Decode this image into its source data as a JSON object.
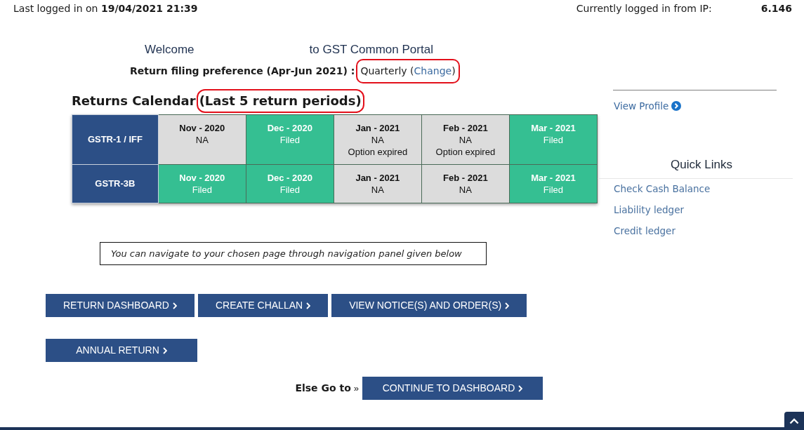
{
  "session": {
    "last_login_label": "Last logged in on",
    "last_login_time": "19/04/2021 21:39",
    "ip_label": "Currently logged in from IP:",
    "ip_value": "6.146"
  },
  "welcome": {
    "greeting": "Welcome",
    "portal": "to GST Common Portal"
  },
  "filing_preference": {
    "label": "Return filing preference (Apr-Jun 2021) :",
    "value": "Quarterly (",
    "link": "Change",
    "value_end": ")",
    "highlighted": true
  },
  "calendar": {
    "title": "Returns Calendar",
    "subtitle": "(Last 5 return periods)",
    "subtitle_highlighted": true,
    "rows": [
      {
        "return_type": "GSTR-1 / IFF",
        "periods": [
          {
            "period": "Nov - 2020",
            "status": "NA",
            "filed": false
          },
          {
            "period": "Dec - 2020",
            "status": "Filed",
            "filed": true
          },
          {
            "period": "Jan - 2021",
            "status": "NA",
            "note": "Option expired",
            "filed": false
          },
          {
            "period": "Feb - 2021",
            "status": "NA",
            "note": "Option expired",
            "filed": false
          },
          {
            "period": "Mar - 2021",
            "status": "Filed",
            "filed": true
          }
        ]
      },
      {
        "return_type": "GSTR-3B",
        "periods": [
          {
            "period": "Nov - 2020",
            "status": "Filed",
            "filed": true
          },
          {
            "period": "Dec - 2020",
            "status": "Filed",
            "filed": true
          },
          {
            "period": "Jan - 2021",
            "status": "NA",
            "filed": false
          },
          {
            "period": "Feb - 2021",
            "status": "NA",
            "filed": false
          },
          {
            "period": "Mar - 2021",
            "status": "Filed",
            "filed": true
          }
        ]
      }
    ]
  },
  "navigation_hint": "You can navigate to your chosen page through navigation panel given below",
  "nav_buttons": [
    [
      {
        "label": "RETURN DASHBOARD"
      },
      {
        "label": "CREATE CHALLAN"
      },
      {
        "label": "VIEW NOTICE(S) AND ORDER(S)"
      }
    ],
    [
      {
        "label": "ANNUAL RETURN"
      }
    ]
  ],
  "else_go_to": {
    "label": "Else Go to",
    "arrow": "»",
    "button": "CONTINUE TO DASHBOARD"
  },
  "sidebar": {
    "view_profile": "View Profile",
    "quick_links_title": "Quick Links",
    "quick_links": [
      "Check Cash Balance",
      "Liability ledger",
      "Credit ledger"
    ]
  }
}
